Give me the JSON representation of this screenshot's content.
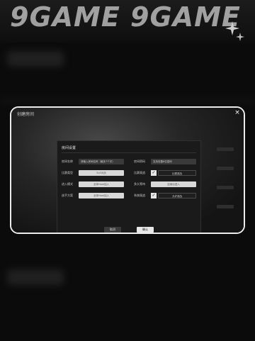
{
  "banner": {
    "text": "9GAME 9GAME"
  },
  "dialog": {
    "title": "创建房间",
    "subtitle": "",
    "close_label": "×",
    "panel": {
      "title": "房间设置",
      "rows": [
        {
          "left": {
            "label": "房间名称",
            "value": "请输入房间名称（最多7个字）"
          },
          "right": {
            "label": "房间密码",
            "value": "支持设置6位密码"
          }
        },
        {
          "left": {
            "label": "比赛类型",
            "value": "5v5对战"
          },
          "right": {
            "label": "比赛观战",
            "value": "比赛观战",
            "checked": true
          }
        },
        {
          "left": {
            "label": "进入模式",
            "value": "全体Host加入"
          },
          "right": {
            "label": "多久等待",
            "value": "结束后进入"
          }
        },
        {
          "left": {
            "label": "选手方案",
            "value": "全体Host加入"
          },
          "right": {
            "label": "系统观战",
            "value": "允许观战",
            "checked": true
          }
        }
      ],
      "cancel_label": "取消",
      "confirm_label": "确认"
    }
  },
  "colors": {
    "background": "#0b0b0b",
    "dialog_border": "#ececec",
    "accent": "#ffffff"
  }
}
